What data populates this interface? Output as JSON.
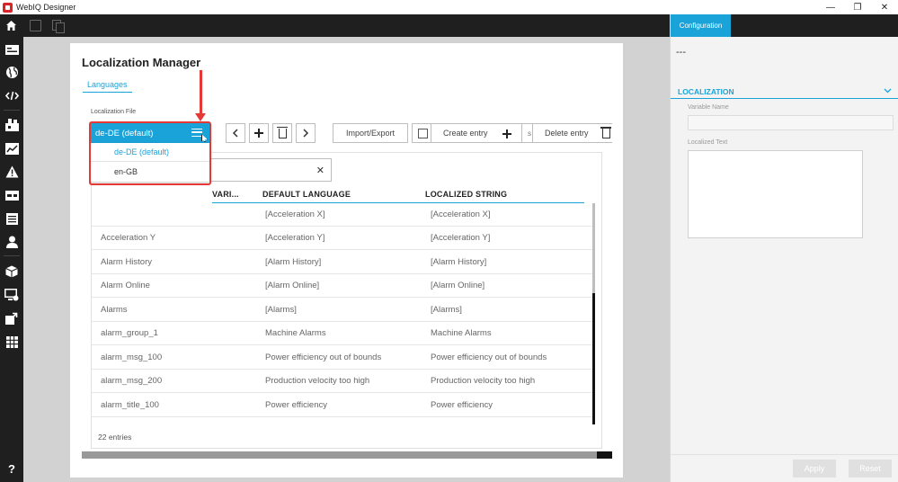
{
  "window": {
    "title": "WebIQ Designer",
    "controls": [
      "—",
      "❐",
      "✕"
    ]
  },
  "canvas": {
    "title": "Localization Manager",
    "tab": "Languages",
    "file_label": "Localization File",
    "selected_language": "de-DE (default)",
    "language_options": [
      "de-DE (default)",
      "en-GB"
    ],
    "buttons": {
      "import_export": "Import/Export",
      "create_entry": "Create entry",
      "delete_entry": "Delete entry",
      "partial_label": "s"
    },
    "table": {
      "headers": [
        "VARI...",
        "DEFAULT LANGUAGE",
        "LOCALIZED STRING"
      ],
      "rows": [
        [
          "",
          "[Acceleration X]",
          "[Acceleration X]"
        ],
        [
          "Acceleration Y",
          "[Acceleration Y]",
          "[Acceleration Y]"
        ],
        [
          "Alarm History",
          "[Alarm History]",
          "[Alarm History]"
        ],
        [
          "Alarm Online",
          "[Alarm Online]",
          "[Alarm Online]"
        ],
        [
          "Alarms",
          "[Alarms]",
          "[Alarms]"
        ],
        [
          "alarm_group_1",
          "Machine Alarms",
          "Machine Alarms"
        ],
        [
          "alarm_msg_100",
          "Power efficiency out of bounds",
          "Power efficiency out of bounds"
        ],
        [
          "alarm_msg_200",
          "Production velocity too high",
          "Production velocity too high"
        ],
        [
          "alarm_title_100",
          "Power efficiency",
          "Power efficiency"
        ]
      ],
      "entries": "22 entries"
    }
  },
  "panel": {
    "tab": "Configuration",
    "placeholder": "---",
    "section": "LOCALIZATION",
    "variable_name_label": "Variable Name",
    "localized_text_label": "Localized Text",
    "apply": "Apply",
    "reset": "Reset"
  },
  "colors": {
    "accent": "#1aa3d9",
    "dark": "#1f1f1f",
    "highlight": "#e53935"
  },
  "help_label": "?"
}
